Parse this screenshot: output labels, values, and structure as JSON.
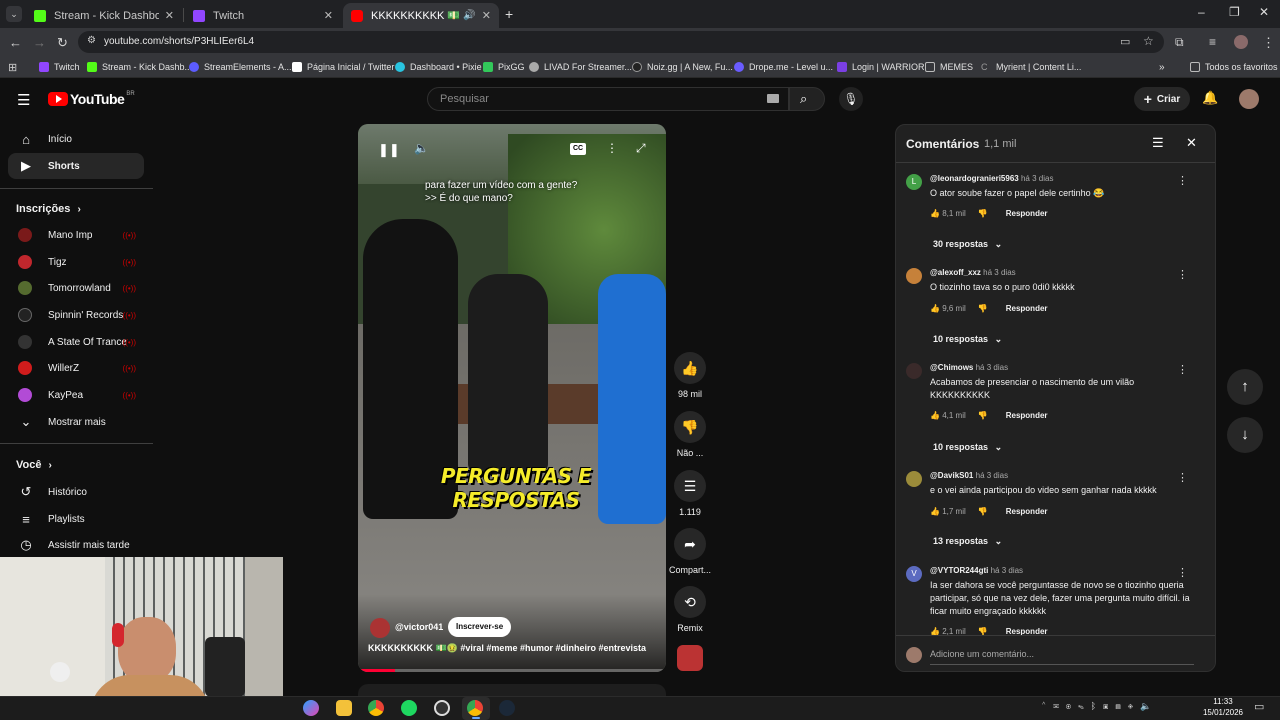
{
  "browser": {
    "tabs": [
      {
        "title": "Stream - Kick Dashboard",
        "color": "#53fc18"
      },
      {
        "title": "Twitch",
        "color": "#9146ff"
      },
      {
        "title": "KKKKKKKKKK 💵🤢 #viral",
        "color": "#ff0000"
      }
    ],
    "url": "youtube.com/shorts/P3HLIEer6L4",
    "bookmarks": [
      {
        "label": "Twitch",
        "color": "#9146ff"
      },
      {
        "label": "Stream - Kick Dashb...",
        "color": "#53fc18"
      },
      {
        "label": "StreamElements - A...",
        "color": "#5c5cff"
      },
      {
        "label": "Página Inicial / Twitter",
        "color": "#ffffff"
      },
      {
        "label": "Dashboard • Pixie",
        "color": "#29c4e0"
      },
      {
        "label": "PixGG",
        "color": "#32c85a"
      },
      {
        "label": "LIVAD For Streamer...",
        "color": "#aaaaaa"
      },
      {
        "label": "Noiz.gg | A New, Fu...",
        "color": "#222222"
      },
      {
        "label": "Drope.me - Level u...",
        "color": "#6a5cff"
      },
      {
        "label": "Login | WARRIOR",
        "color": "#7b3fe4"
      },
      {
        "label": "MEMES",
        "color": "#bbbbbb"
      },
      {
        "label": "Myrient | Content Li...",
        "color": "#999999"
      }
    ],
    "all_bookmarks": "Todos os favoritos"
  },
  "youtube": {
    "logo_text": "YouTube",
    "country": "BR",
    "search_placeholder": "Pesquisar",
    "create_label": "Criar",
    "sidebar": {
      "main": [
        {
          "label": "Início",
          "icon": "home-icon"
        },
        {
          "label": "Shorts",
          "icon": "shorts-icon"
        }
      ],
      "subs_heading": "Inscrições",
      "channels": [
        {
          "name": "Mano Imp",
          "color": "#7a1a1a"
        },
        {
          "name": "Tigz",
          "color": "#c0272d"
        },
        {
          "name": "Tomorrowland",
          "color": "#556b2f"
        },
        {
          "name": "Spinnin' Records",
          "color": "#222222"
        },
        {
          "name": "A State Of Trance",
          "color": "#333333"
        },
        {
          "name": "WillerZ",
          "color": "#d01c1c"
        },
        {
          "name": "KayPea",
          "color": "#b24bd6"
        }
      ],
      "show_more": "Mostrar mais",
      "you_heading": "Você",
      "you_items": [
        {
          "label": "Histórico",
          "icon": "history-icon"
        },
        {
          "label": "Playlists",
          "icon": "playlists-icon"
        },
        {
          "label": "Assistir mais tarde",
          "icon": "watch-later-icon"
        }
      ]
    },
    "video": {
      "caption_line1": "para fazer um vídeo com a gente?",
      "caption_line2": ">> É do que mano?",
      "overlay_title": "PERGUNTAS E RESPOSTAS",
      "channel": "@victor041",
      "subscribe": "Inscrever-se",
      "description": "KKKKKKKKKK 💵🤢 #viral #meme #humor #dinheiro #entrevista",
      "progress": 0.12
    },
    "actions": {
      "likes": "98 mil",
      "dislike": "Não ...",
      "comments": "1.119",
      "share": "Compart...",
      "remix": "Remix"
    },
    "comments": {
      "title": "Comentários",
      "count": "1,1 mil",
      "items": [
        {
          "user": "@leonardogranieri5963",
          "time": "há 3 dias",
          "text": "O ator soube fazer o papel dele certinho 😂",
          "likes": "8,1 mil",
          "reply": "Responder",
          "replies": "30 respostas",
          "avatar_letter": "L",
          "avatar_color": "#43a047"
        },
        {
          "user": "@alexoff_xxz",
          "time": "há 3 dias",
          "text": "O tiozinho tava so o puro 0di0 kkkkk",
          "likes": "9,6 mil",
          "reply": "Responder",
          "replies": "10 respostas",
          "avatar_letter": "",
          "avatar_color": "#c6813a"
        },
        {
          "user": "@Chimows",
          "time": "há 3 dias",
          "text": "Acabamos de presenciar o nascimento de um vilão KKKKKKKKKK",
          "likes": "4,1 mil",
          "reply": "Responder",
          "replies": "10 respostas",
          "avatar_letter": "",
          "avatar_color": "#3a2a2a"
        },
        {
          "user": "@DavikS01",
          "time": "há 3 dias",
          "text": "e o vei ainda participou do video sem ganhar nada kkkkk",
          "likes": "1,7 mil",
          "reply": "Responder",
          "replies": "13 respostas",
          "avatar_letter": "",
          "avatar_color": "#9b8b3a"
        },
        {
          "user": "@VYTOR244gti",
          "time": "há 3 dias",
          "text": "Ia ser dahora se você perguntasse de novo se o tiozinho queria participar, só que na vez dele, fazer uma pergunta muito difícil. ia ficar muito engraçado kkkkkk",
          "likes": "2,1 mil",
          "reply": "Responder",
          "replies": "",
          "avatar_letter": "V",
          "avatar_color": "#5c6bc0"
        }
      ],
      "add_placeholder": "Adicione um comentário..."
    }
  },
  "taskbar": {
    "time": "11:33",
    "date": "15/01/2026"
  }
}
